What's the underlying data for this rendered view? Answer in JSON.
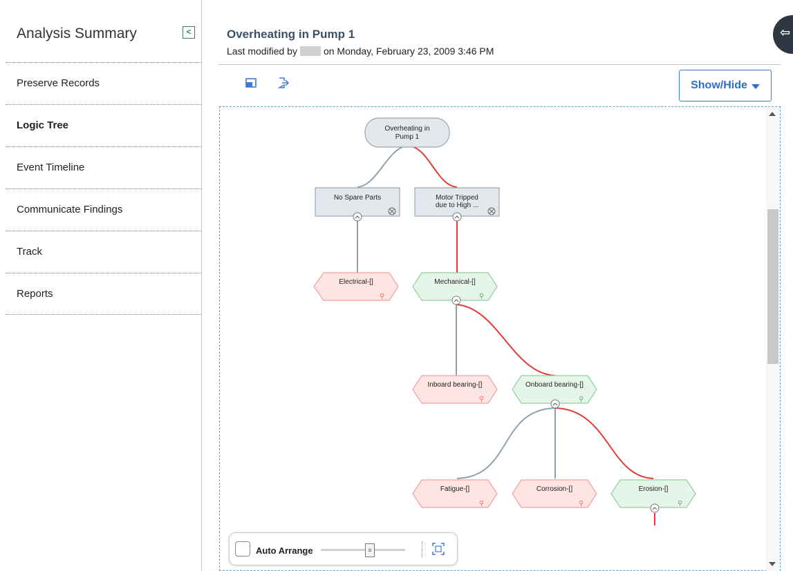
{
  "sidebar": {
    "title": "Analysis Summary",
    "collapse_glyph": "<",
    "items": [
      {
        "label": "Preserve Records"
      },
      {
        "label": "Logic Tree"
      },
      {
        "label": "Event Timeline"
      },
      {
        "label": "Communicate Findings"
      },
      {
        "label": "Track"
      },
      {
        "label": "Reports"
      }
    ]
  },
  "header": {
    "title": "Overheating in Pump 1",
    "modified_prefix": "Last modified by",
    "modified_suffix": "on Monday, February 23, 2009 3:46 PM"
  },
  "toolbar": {
    "show_hide_label": "Show/Hide"
  },
  "tree": {
    "root": {
      "line1": "Overheating in",
      "line2": "Pump 1"
    },
    "nodes": {
      "no_spare_parts": "No Spare Parts",
      "motor_tripped_1": "Motor Tripped",
      "motor_tripped_2": "due to High ...",
      "electrical": "Electrical-[]",
      "mechanical": "Mechanical-[]",
      "inboard": "Inboard bearing-[]",
      "onboard": "Onboard bearing-[]",
      "fatigue": "Fatigue-[]",
      "corrosion": "Corrosion-[]",
      "erosion": "Erosion-[]"
    },
    "colors": {
      "false_fill": "#fde5e3",
      "false_stroke": "#f0a29c",
      "true_fill": "#e6f5e9",
      "true_stroke": "#8fcf9c",
      "neutral_fill": "#e4e8ec",
      "neutral_stroke": "#9aa6b2",
      "red_link": "#e53935",
      "grey_link": "#8fa0ae"
    }
  },
  "auto_arrange": {
    "label": "Auto Arrange",
    "checked": false,
    "zoom_thumb_glyph": "≡"
  },
  "icons": [
    "collapse-sidebar-icon",
    "panel-icon",
    "export-icon",
    "caret-down-icon",
    "fit-to-screen-icon",
    "person-icon",
    "cancel-icon",
    "chevron-up-icon"
  ]
}
